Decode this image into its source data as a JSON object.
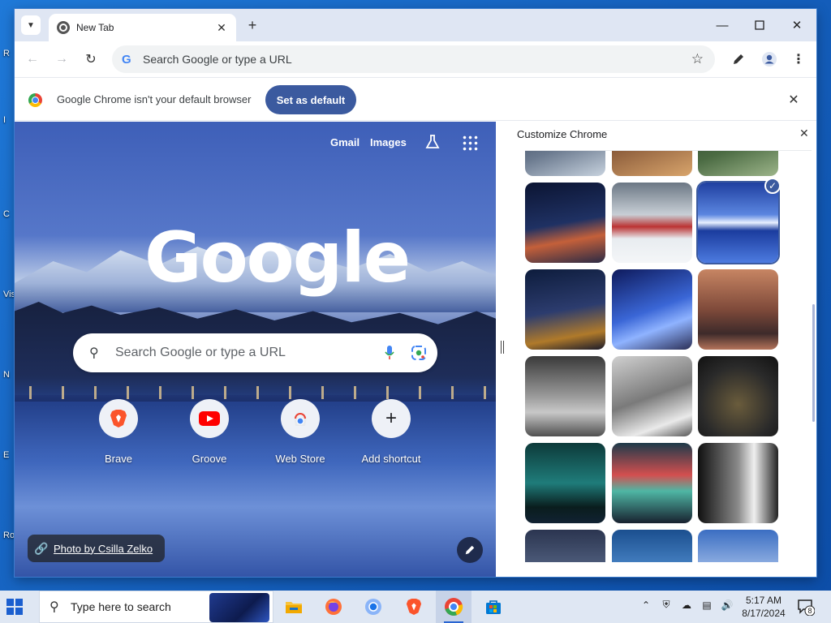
{
  "desktop": {
    "icon_labels": [
      "R",
      "I",
      "C",
      "Vis",
      "N",
      "E",
      "Ro"
    ]
  },
  "browser": {
    "tab": {
      "title": "New Tab"
    },
    "omnibox": {
      "placeholder": "Search Google or type a URL"
    },
    "infobar": {
      "message": "Google Chrome isn't your default browser",
      "button_label": "Set as default"
    }
  },
  "ntp": {
    "links": {
      "gmail": "Gmail",
      "images": "Images"
    },
    "logo": "Google",
    "search_placeholder": "Search Google or type a URL",
    "shortcuts": [
      {
        "label": "Brave",
        "icon": "brave-icon"
      },
      {
        "label": "Groove",
        "icon": "youtube-icon"
      },
      {
        "label": "Web Store",
        "icon": "chrome-web-store-icon"
      },
      {
        "label": "Add shortcut",
        "icon": "plus-icon"
      }
    ],
    "photo_credit": "Photo by Csilla Zelko"
  },
  "customize_panel": {
    "title": "Customize Chrome",
    "selected_wallpaper": "Lake at dusk with snowy mountains",
    "wallpapers": [
      "Snowy village at dusk",
      "Half-timbered houses",
      "Forest landscape",
      "Castle at night",
      "Red cabins on a frozen lake",
      "Lake at dusk with snowy mountains",
      "Bridge lit at night",
      "Skyscrapers looking up",
      "City canals at sunset",
      "Covered bridge walkway",
      "Aerial city view",
      "Domed building at night",
      "Suspension bridge at night",
      "Colorful apartment towers",
      "Tall building in fog",
      "Night city skyline",
      "Clouds over hills",
      "City skyline at dusk"
    ]
  },
  "taskbar": {
    "search_placeholder": "Type here to search",
    "apps": [
      "file-explorer-icon",
      "firefox-icon",
      "chrome-alt-icon",
      "brave-icon",
      "chrome-icon",
      "microsoft-store-icon"
    ],
    "clock": {
      "time": "5:17 AM",
      "date": "8/17/2024"
    },
    "notification_count": "8"
  },
  "colors": {
    "accent": "#3b5a9f",
    "tabstrip": "#dfe6f3",
    "taskbar": "#dfe7f3"
  }
}
